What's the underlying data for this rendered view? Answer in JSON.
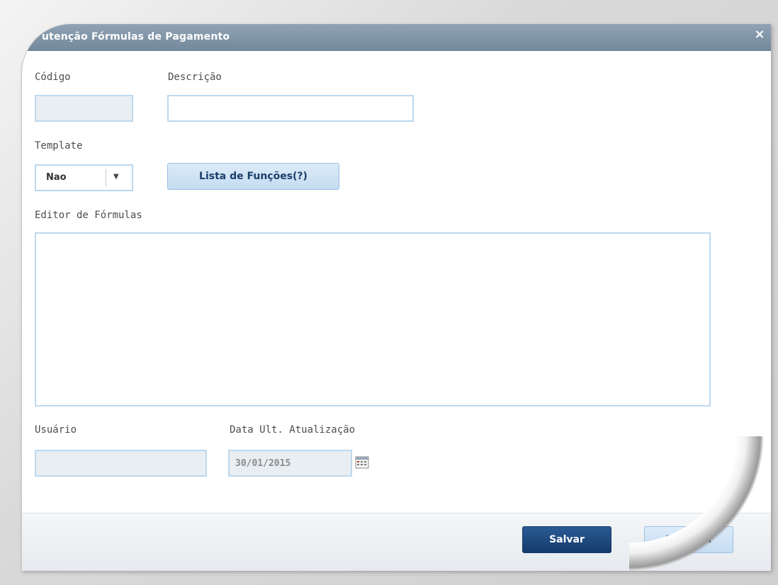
{
  "dialog": {
    "title": "utenção Fórmulas de Pagamento",
    "close_label": "×"
  },
  "form": {
    "codigo_label": "Código",
    "codigo_value": "",
    "descricao_label": "Descrição",
    "descricao_value": "",
    "template_label": "Template",
    "template_selected": "Nao",
    "lista_button_label": "Lista de Funções(?)",
    "editor_label": "Editor de Fórmulas",
    "editor_value": "",
    "usuario_label": "Usuário",
    "usuario_value": "",
    "data_label": "Data Ult. Atualização",
    "data_value": "30/01/2015"
  },
  "footer": {
    "save_label": "Salvar",
    "cancel_label": "Cancelar"
  },
  "icons": {
    "close": "close-icon",
    "dropdown": "chevron-down-icon",
    "calendar": "calendar-icon"
  },
  "colors": {
    "titlebar": "#7f93a6",
    "field_border": "#bcd8ee",
    "primary_button": "#1d4a80",
    "secondary_button": "#cfe2f5"
  }
}
